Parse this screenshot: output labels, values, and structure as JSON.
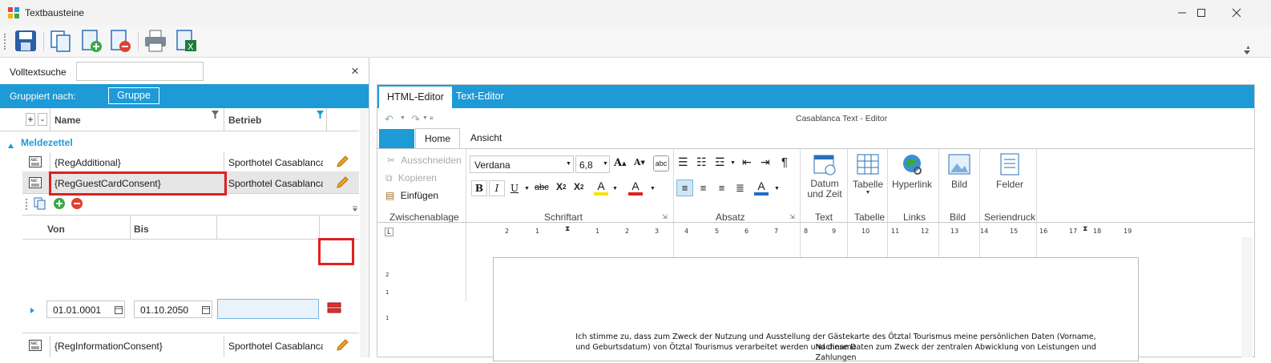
{
  "window": {
    "title": "Textbausteine",
    "controls": [
      "minimize",
      "maximize",
      "close"
    ]
  },
  "toolbar": {
    "buttons": [
      "save-icon",
      "copy-document-icon",
      "new-document-icon",
      "delete-document-icon",
      "print-icon",
      "excel-export-icon"
    ]
  },
  "search": {
    "label": "Volltextsuche",
    "value": "",
    "clear": "×"
  },
  "grouping": {
    "label": "Gruppiert nach:",
    "chip": "Gruppe"
  },
  "grid": {
    "expand_buttons": [
      "+",
      "-"
    ],
    "columns": [
      "Name",
      "Betrieb"
    ],
    "group": {
      "name": "Meldezettel"
    },
    "rows": [
      {
        "name": "{RegAdditional}",
        "betrieb": "Sporthotel Casablanca",
        "icon": "abc-icon"
      },
      {
        "name": "{RegGuestCardConsent}",
        "betrieb": "Sporthotel Casablanca",
        "icon": "abc-icon"
      },
      {
        "name": "{RegInformationConsent}",
        "betrieb": "Sporthotel Casablanca",
        "icon": "abc-icon"
      }
    ],
    "detail": {
      "columns": [
        "Von",
        "Bis"
      ],
      "row": {
        "von": "01.01.0001",
        "bis": "01.10.2050"
      }
    }
  },
  "editor": {
    "tabs": [
      "HTML-Editor",
      "Text-Editor"
    ],
    "active_tab": "HTML-Editor",
    "caption": "Casablanca Text - Editor",
    "ribbon_tabs": [
      "Home",
      "Ansicht"
    ],
    "clipboard": {
      "cut": "Ausschneiden",
      "copy": "Kopieren",
      "paste": "Einfügen",
      "group": "Zwischenablage"
    },
    "font": {
      "family": "Verdana",
      "size": "6,8",
      "group": "Schriftart"
    },
    "paragraph_group": "Absatz",
    "text_group": {
      "button": "Datum\nund Zeit",
      "label": "Text"
    },
    "table_group": {
      "button": "Tabelle",
      "label": "Tabelle"
    },
    "links_group": {
      "button": "Hyperlink",
      "label": "Links"
    },
    "image_group": {
      "button": "Bild",
      "label": "Bild"
    },
    "merge_group": {
      "button": "Felder",
      "label": "Seriendruck"
    },
    "ruler": [
      "2",
      "1",
      "1",
      "2",
      "3",
      "4",
      "5",
      "6",
      "7",
      "8",
      "9",
      "10",
      "11",
      "12",
      "13",
      "14",
      "15",
      "16",
      "17",
      "18",
      "19"
    ],
    "vruler": [
      "2",
      "1",
      "1"
    ],
    "document_text": [
      "Ich stimme zu, dass zum Zweck der Nutzung und Ausstellung der Gästekarte des Ötztal Tourismus meine persönlichen Daten (Vorname, Nachname",
      "und Geburtsdatum) von Ötztal Tourismus verarbeitet werden und diese Daten zum Zweck der zentralen Abwicklung von Leistungen und Zahlungen"
    ]
  },
  "colors": {
    "accent": "#1e9ad6",
    "highlight_box": "#e02020",
    "selected_row": "#e6e6e6"
  }
}
